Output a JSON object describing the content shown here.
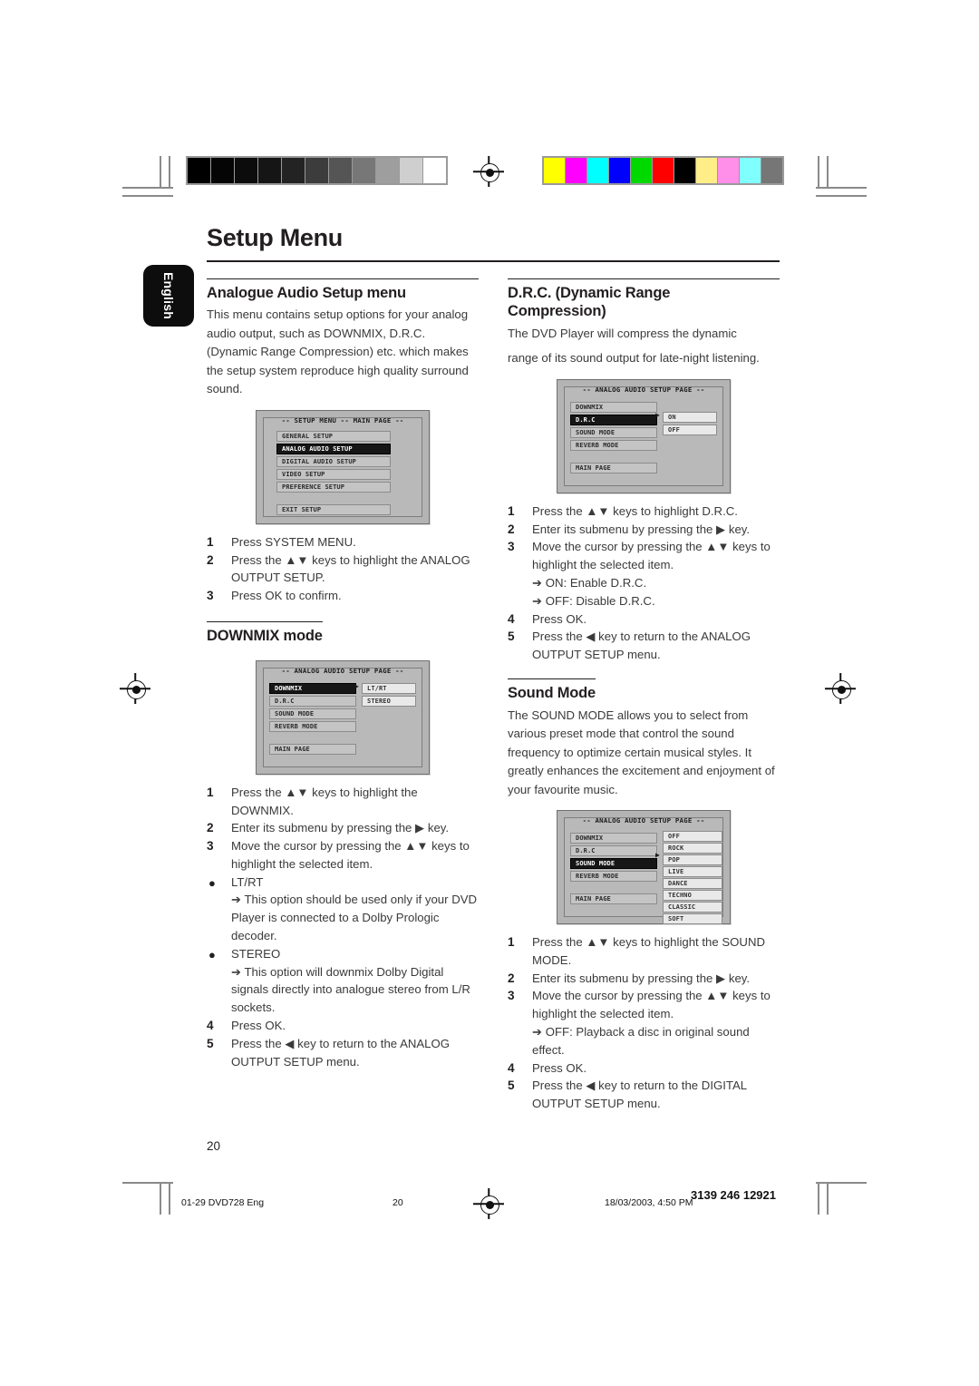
{
  "document": {
    "title": "Setup Menu",
    "language_tab": "English",
    "folio": "20"
  },
  "left_column": {
    "section1": {
      "heading": "Analogue Audio Setup menu",
      "paragraph": "This menu contains setup options for your analog audio output, such as DOWNMIX, D.R.C. (Dynamic Range Compression) etc. which makes the setup system reproduce high quality surround sound.",
      "screenshot": {
        "name": "setup-menu-main-page",
        "title": "-- SETUP MENU -- MAIN PAGE --",
        "items": [
          {
            "label": "GENERAL SETUP",
            "highlighted": false
          },
          {
            "label": "ANALOG AUDIO SETUP",
            "highlighted": true
          },
          {
            "label": "DIGITAL AUDIO SETUP",
            "highlighted": false
          },
          {
            "label": "VIDEO SETUP",
            "highlighted": false
          },
          {
            "label": "PREFERENCE SETUP",
            "highlighted": false
          }
        ],
        "exit_item": "EXIT SETUP"
      },
      "steps": [
        {
          "num": "1",
          "text": "Press SYSTEM MENU."
        },
        {
          "num": "2",
          "text": "Press the ▲▼ keys to highlight the ANALOG OUTPUT SETUP."
        },
        {
          "num": "3",
          "text": "Press OK to confirm."
        }
      ]
    },
    "section2": {
      "heading": "DOWNMIX mode",
      "screenshot": {
        "name": "analog-audio-setup-downmix",
        "title": "-- ANALOG AUDIO SETUP PAGE --",
        "items": [
          {
            "label": "DOWNMIX",
            "highlighted": true
          },
          {
            "label": "D.R.C",
            "highlighted": false
          },
          {
            "label": "SOUND MODE",
            "highlighted": false
          },
          {
            "label": "REVERB MODE",
            "highlighted": false
          }
        ],
        "main_page_item": "MAIN PAGE",
        "submenu": [
          {
            "label": "LT/RT",
            "selected": false
          },
          {
            "label": "STEREO",
            "selected": true
          }
        ]
      },
      "steps": [
        {
          "num": "1",
          "text": "Press the ▲▼ keys to highlight the DOWNMIX."
        },
        {
          "num": "2",
          "text": "Enter its submenu by pressing the ▶  key."
        },
        {
          "num": "3",
          "text": "Move the cursor by pressing the ▲▼ keys to highlight the selected item."
        }
      ],
      "bullets": [
        {
          "label": "LT/RT",
          "note": "➔  This option should be used only if your DVD Player is connected to a Dolby Prologic decoder."
        },
        {
          "label": "STEREO",
          "note": "➔  This option will downmix Dolby Digital signals directly into analogue stereo from L/R sockets."
        }
      ],
      "steps_tail": [
        {
          "num": "4",
          "text": "Press OK."
        },
        {
          "num": "5",
          "text": "Press the ◀ key to return to the ANALOG OUTPUT SETUP menu."
        }
      ]
    }
  },
  "right_column": {
    "section1": {
      "heading_line1": "D.R.C. (Dynamic Range",
      "heading_line2": "Compression)",
      "paragraph_line1": "The DVD Player will compress the dynamic",
      "paragraph_line2": "range of its sound output for late-night listening.",
      "screenshot": {
        "name": "analog-audio-setup-drc",
        "title": "-- ANALOG AUDIO SETUP PAGE --",
        "items": [
          {
            "label": "DOWNMIX",
            "highlighted": false
          },
          {
            "label": "D.R.C",
            "highlighted": true
          },
          {
            "label": "SOUND MODE",
            "highlighted": false
          },
          {
            "label": "REVERB MODE",
            "highlighted": false
          }
        ],
        "main_page_item": "MAIN PAGE",
        "submenu": [
          {
            "label": "ON",
            "selected": false
          },
          {
            "label": "OFF",
            "selected": true
          }
        ]
      },
      "steps": [
        {
          "num": "1",
          "text": "Press the ▲▼ keys to highlight D.R.C."
        },
        {
          "num": "2",
          "text": "Enter its submenu by pressing the ▶  key."
        },
        {
          "num": "3",
          "text": "Move the cursor by pressing the ▲▼ keys to highlight the selected item."
        }
      ],
      "arrows": [
        "➔  ON: Enable D.R.C.",
        "➔  OFF: Disable D.R.C."
      ],
      "steps_tail": [
        {
          "num": "4",
          "text": "Press OK."
        },
        {
          "num": "5",
          "text": "Press the ◀ key to return to the ANALOG OUTPUT SETUP menu."
        }
      ]
    },
    "section2": {
      "heading": "Sound Mode",
      "paragraph": "The SOUND MODE allows you to select from various preset mode that control the sound frequency to optimize certain musical styles. It greatly enhances the excitement and enjoyment of your favourite music.",
      "screenshot": {
        "name": "analog-audio-setup-sound-mode",
        "title": "-- ANALOG AUDIO SETUP PAGE --",
        "items": [
          {
            "label": "DOWNMIX",
            "highlighted": false
          },
          {
            "label": "D.R.C",
            "highlighted": false
          },
          {
            "label": "SOUND MODE",
            "highlighted": true
          },
          {
            "label": "REVERB MODE",
            "highlighted": false
          }
        ],
        "main_page_item": "MAIN PAGE",
        "submenu": [
          {
            "label": "OFF",
            "selected": true
          },
          {
            "label": "ROCK",
            "selected": false
          },
          {
            "label": "POP",
            "selected": false
          },
          {
            "label": "LIVE",
            "selected": false
          },
          {
            "label": "DANCE",
            "selected": false
          },
          {
            "label": "TECHNO",
            "selected": false
          },
          {
            "label": "CLASSIC",
            "selected": false
          },
          {
            "label": "SOFT",
            "selected": false
          }
        ]
      },
      "steps": [
        {
          "num": "1",
          "text": "Press the ▲▼ keys to highlight the SOUND MODE."
        },
        {
          "num": "2",
          "text": "Enter its submenu by pressing the ▶  key."
        },
        {
          "num": "3",
          "text": "Move the cursor by pressing the ▲▼ keys to highlight the selected item."
        }
      ],
      "arrows": [
        "➔ OFF: Playback a disc in original sound effect."
      ],
      "steps_tail": [
        {
          "num": "4",
          "text": "Press OK."
        },
        {
          "num": "5",
          "text": "Press the ◀ key to return to the DIGITAL OUTPUT SETUP menu."
        }
      ]
    }
  },
  "footer": {
    "file": "01-29 DVD728 Eng",
    "page": "20",
    "timestamp": "18/03/2003, 4:50 PM",
    "code": "3139 246 12921"
  },
  "calibration": {
    "grayscale": [
      "#000000",
      "#050505",
      "#0c0c0c",
      "#151515",
      "#232323",
      "#3c3c3c",
      "#555555",
      "#777777",
      "#9e9e9e",
      "#cfcfcf",
      "#ffffff"
    ],
    "colors": [
      "#ffff00",
      "#ff00ff",
      "#00ffff",
      "#0000ff",
      "#00d900",
      "#ff0000",
      "#000000",
      "#ffee88",
      "#ff8fe8",
      "#80ffff",
      "#767676"
    ]
  }
}
